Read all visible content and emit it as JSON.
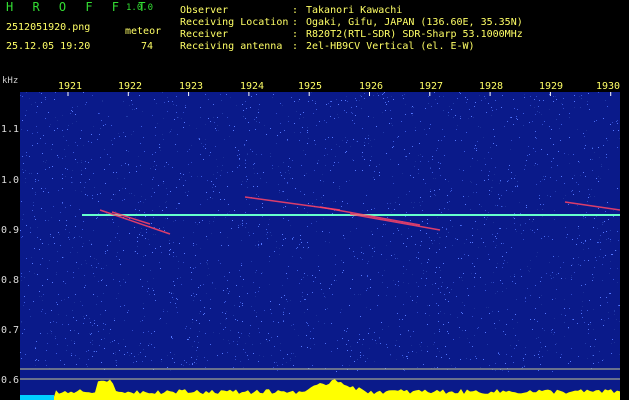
{
  "header": {
    "brand": "H R O F F T",
    "version": "1.0.0",
    "filename": "2512051920.png",
    "meteor_label": "meteor",
    "datetime": "25.12.05 19:20",
    "meteor_count": "74",
    "info": [
      {
        "key": "Observer",
        "value": "Takanori Kawachi"
      },
      {
        "key": "Receiving Location",
        "value": "Ogaki, Gifu, JAPAN (136.60E, 35.35N)"
      },
      {
        "key": "Receiver",
        "value": "R820T2(RTL-SDR) SDR-Sharp 53.1000MHz"
      },
      {
        "key": "Receiving antenna",
        "value": "2el-HB9CV Vertical (el. E-W)"
      }
    ],
    "separator": ":"
  },
  "axes": {
    "y_unit": "kHz",
    "y_ticks": [
      "1.1",
      "1.0",
      "0.9",
      "0.8",
      "0.7",
      "0.6"
    ],
    "x_ticks": [
      "1921",
      "1922",
      "1923",
      "1924",
      "1925",
      "1926",
      "1927",
      "1928",
      "1929",
      "1930"
    ]
  },
  "colors": {
    "background": "#000000",
    "plot_bg": "#0a1a8a",
    "header_text": "#FFFF66",
    "brand": "#33dd33",
    "carrier": "#66ffcc",
    "meteor": "#ff4466",
    "histogram": "#FFFF00",
    "baseline": "#00d0ff"
  }
}
